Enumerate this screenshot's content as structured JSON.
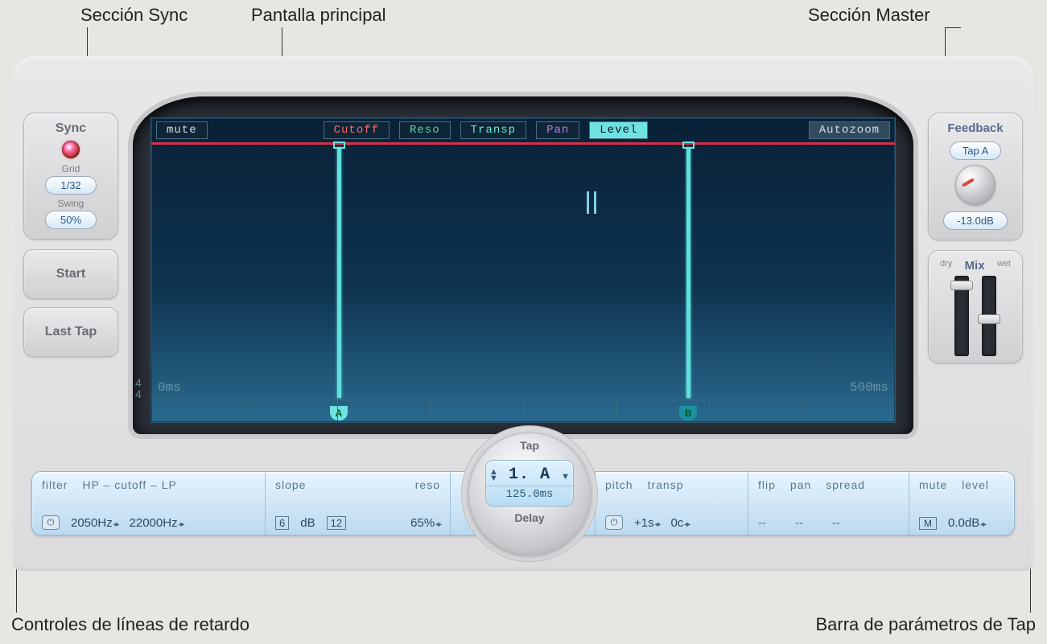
{
  "callouts": {
    "sync": "Sección Sync",
    "main": "Pantalla principal",
    "master": "Sección Master",
    "delay_lines": "Controles de líneas de retardo",
    "tap_bar": "Barra de parámetros de Tap"
  },
  "sync": {
    "title": "Sync",
    "grid_label": "Grid",
    "grid_value": "1/32",
    "swing_label": "Swing",
    "swing_value": "50%"
  },
  "left_buttons": {
    "start": "Start",
    "last_tap": "Last Tap"
  },
  "master": {
    "feedback_title": "Feedback",
    "feedback_tap": "Tap A",
    "feedback_value": "-13.0dB",
    "mix_title": "Mix",
    "mix_dry": "dry",
    "mix_wet": "wet"
  },
  "display": {
    "mute": "mute",
    "cutoff": "Cutoff",
    "reso": "Reso",
    "transp": "Transp",
    "pan": "Pan",
    "level": "Level",
    "autozoom": "Autozoom",
    "time_start": "0ms",
    "time_end": "500ms",
    "tsig_top": "4",
    "tsig_bot": "4",
    "taps": [
      {
        "name": "A",
        "pos_pct": 25.0,
        "selected": true
      },
      {
        "name": "B",
        "pos_pct": 72.0,
        "selected": false
      }
    ]
  },
  "tap_dial": {
    "top": "Tap",
    "name": "1. A",
    "time": "125.0ms",
    "bottom": "Delay"
  },
  "params": {
    "filter": {
      "head": "filter",
      "cutoff_head": "HP – cutoff – LP",
      "hp": "2050Hz",
      "lp": "22000Hz"
    },
    "slope": {
      "head_slope": "slope",
      "head_reso": "reso",
      "val1": "6",
      "db": "dB",
      "val2": "12",
      "reso": "65%"
    },
    "pitch": {
      "head_pitch": "pitch",
      "head_transp": "transp",
      "plus1s": "+1s",
      "oc": "0c"
    },
    "spread": {
      "head_flip": "flip",
      "head_pan": "pan",
      "head_spread": "spread",
      "dash": "--"
    },
    "level": {
      "head_mute": "mute",
      "head_level": "level",
      "m": "M",
      "val": "0.0dB"
    }
  }
}
